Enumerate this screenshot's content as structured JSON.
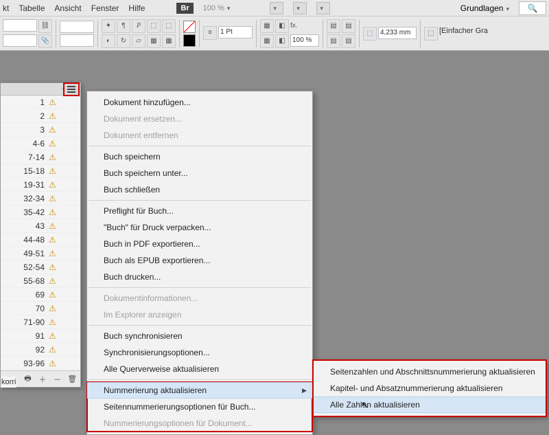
{
  "menubar": [
    "kt",
    "Tabelle",
    "Ansicht",
    "Fenster",
    "Hilfe"
  ],
  "br_label": "Br",
  "zoom_label": "100 %",
  "workspace_label": "Grundlagen",
  "stroke_pt": "1 Pt",
  "scale_pct": "100 %",
  "snap_val": "4,233 mm",
  "right_label": "[Einfacher Gra",
  "truncate_label": "korri",
  "pages": [
    "1",
    "2",
    "3",
    "4-6",
    "7-14",
    "15-18",
    "19-31",
    "32-34",
    "35-42",
    "43",
    "44-48",
    "49-51",
    "52-54",
    "55-68",
    "69",
    "70",
    "71-90",
    "91",
    "92",
    "93-96"
  ],
  "menu": {
    "doc_add": "Dokument hinzufügen...",
    "doc_replace": "Dokument ersetzen...",
    "doc_remove": "Dokument entfernen",
    "book_save": "Buch speichern",
    "book_save_as": "Buch speichern unter...",
    "book_close": "Buch schließen",
    "preflight": "Preflight für Buch...",
    "package": "\"Buch\" für Druck verpacken...",
    "export_pdf": "Buch in PDF exportieren...",
    "export_epub": "Buch als EPUB exportieren...",
    "print": "Buch drucken...",
    "doc_info": "Dokumentinformationen...",
    "explorer": "Im Explorer anzeigen",
    "sync": "Buch synchronisieren",
    "sync_opts": "Synchronisierungsoptionen...",
    "xref": "Alle Querverweise aktualisieren",
    "numbering": "Nummerierung aktualisieren",
    "page_num_opts": "Seitennummerierungsoptionen für Buch...",
    "doc_num_opts": "Nummerierungsoptionen für Dokument..."
  },
  "submenu": {
    "page_section": "Seitenzahlen und Abschnittsnummerierung aktualisieren",
    "chapter_para": "Kapitel- und Absatznummerierung aktualisieren",
    "all_nums": "Alle Zahlen aktualisieren"
  }
}
